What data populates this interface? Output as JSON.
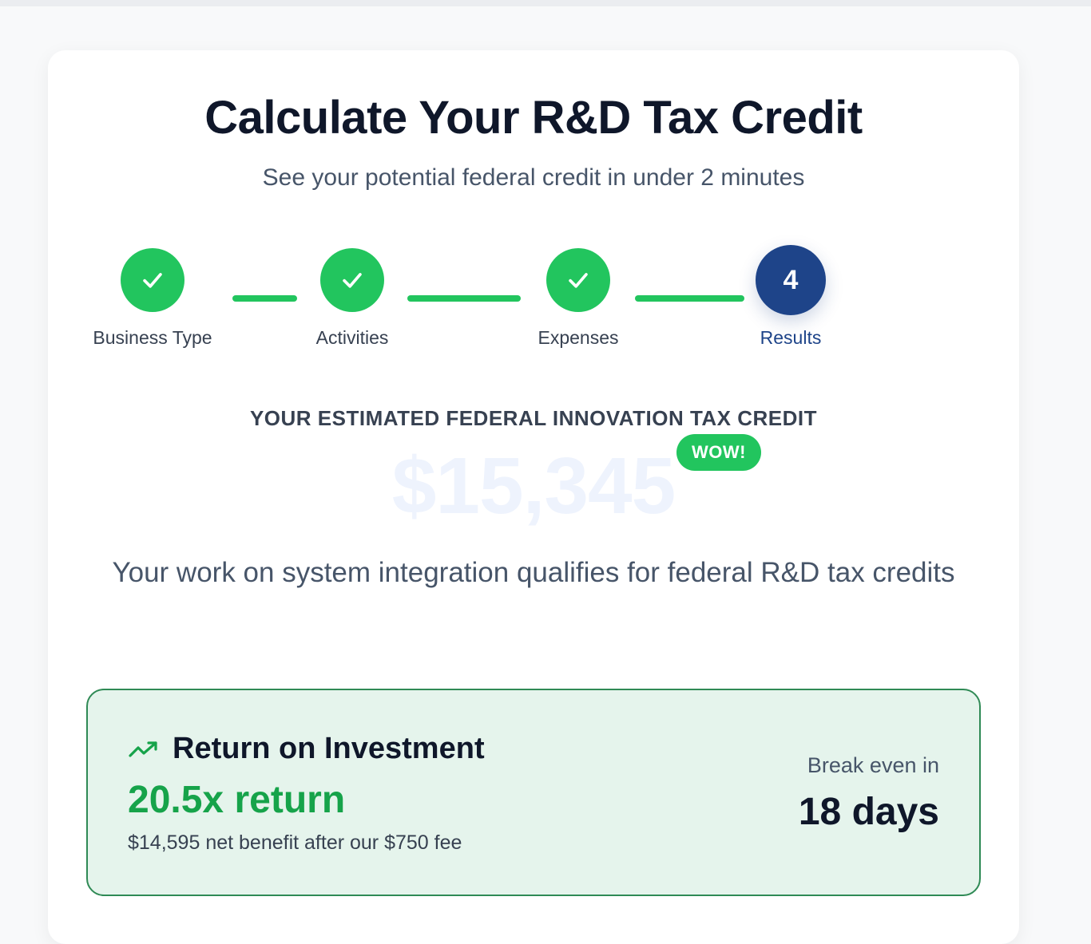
{
  "header": {
    "title": "Calculate Your R&D Tax Credit",
    "subtitle": "See your potential federal credit in under 2 minutes"
  },
  "steps": [
    {
      "label": "Business Type",
      "status": "completed"
    },
    {
      "label": "Activities",
      "status": "completed"
    },
    {
      "label": "Expenses",
      "status": "completed"
    },
    {
      "label": "Results",
      "status": "current",
      "number": "4"
    }
  ],
  "result": {
    "heading": "YOUR ESTIMATED FEDERAL INNOVATION TAX CREDIT",
    "amount": "$15,345",
    "badge": "WOW!",
    "description": "Your work on system integration qualifies for federal R&D tax credits"
  },
  "roi": {
    "icon": "trending-up-icon",
    "title": "Return on Investment",
    "return_value": "20.5x return",
    "net_benefit": "$14,595 net benefit after our $750 fee",
    "break_even_label": "Break even in",
    "break_even_value": "18 days"
  },
  "colors": {
    "accent_green": "#22c55e",
    "primary_blue": "#1e4489",
    "roi_background": "#e5f4ec",
    "roi_border": "#2f8a55"
  }
}
